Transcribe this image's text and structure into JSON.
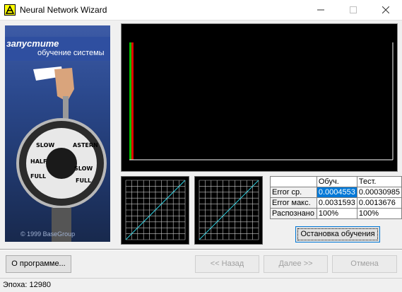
{
  "window": {
    "title": "Neural Network Wizard"
  },
  "side": {
    "heading": "запустите",
    "subheading": "обучение системы",
    "copyright": "© 1999 BaseGroup"
  },
  "stats": {
    "columns": [
      "",
      "Обуч.",
      "Тест."
    ],
    "rows": [
      {
        "label": "Error ср.",
        "train": "0.0004553",
        "test": "0.00030985"
      },
      {
        "label": "Error макс.",
        "train": "0.0031593",
        "test": "0.0013676"
      },
      {
        "label": "Распознано",
        "train": "100%",
        "test": "100%"
      }
    ]
  },
  "buttons": {
    "stop": "Остановка обучения",
    "about": "О программе...",
    "back": "<< Назад",
    "next": "Далее >>",
    "cancel": "Отмена"
  },
  "status": {
    "epoch": "Эпоха: 12980"
  },
  "colors": {
    "bar_green": "#00c000",
    "bar_red": "#e00000",
    "plot_line": "#30d0e0",
    "grid": "#c8c8c8"
  }
}
